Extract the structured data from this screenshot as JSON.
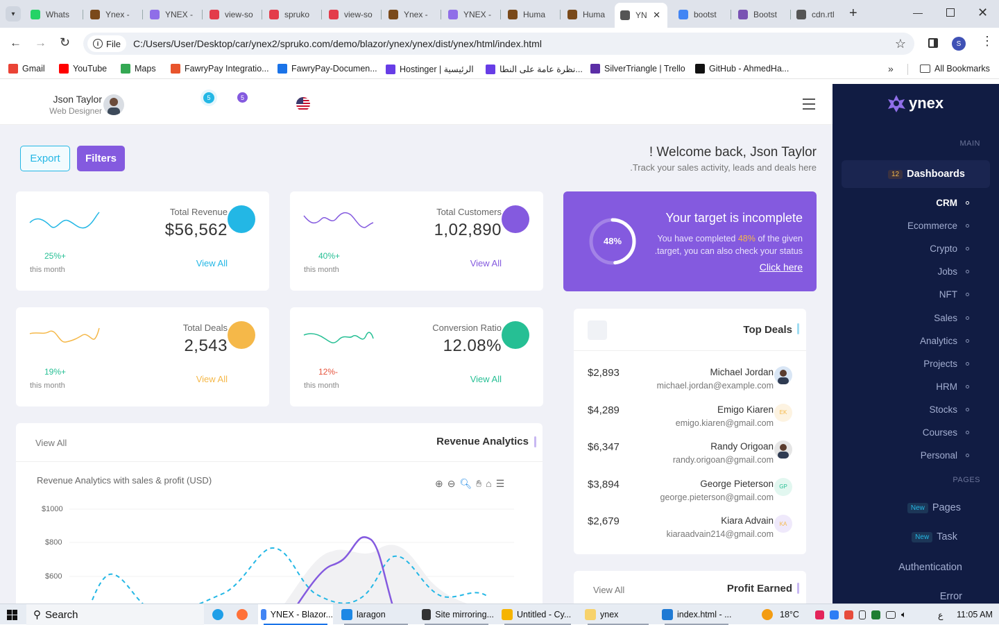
{
  "browser": {
    "tabs": [
      {
        "title": "Whats",
        "color": "#25d366"
      },
      {
        "title": "Ynex -",
        "color": "#7a4a1a"
      },
      {
        "title": "YNEX -",
        "color": "#8f6ee8"
      },
      {
        "title": "view-so",
        "color": "#e33b4a"
      },
      {
        "title": "spruko",
        "color": "#e33b4a"
      },
      {
        "title": "view-so",
        "color": "#e33b4a"
      },
      {
        "title": "Ynex -",
        "color": "#7a4a1a"
      },
      {
        "title": "YNEX -",
        "color": "#8f6ee8"
      },
      {
        "title": "Huma",
        "color": "#7a4a1a"
      },
      {
        "title": "Huma",
        "color": "#7a4a1a"
      },
      {
        "title": "YN",
        "color": "#555"
      },
      {
        "title": "bootst",
        "color": "#4285f4"
      },
      {
        "title": "Bootst",
        "color": "#7952b3"
      },
      {
        "title": "cdn.rtl",
        "color": "#555"
      }
    ],
    "address": {
      "scheme_label": "File",
      "url": "C:/Users/User/Desktop/car/ynex2/spruko.com/demo/blazor/ynex/ynex/dist/ynex/html/index.html"
    },
    "profile_initial": "S",
    "bookmarks": [
      {
        "label": "Gmail",
        "color": "#ea4335"
      },
      {
        "label": "YouTube",
        "color": "#ff0000"
      },
      {
        "label": "Maps",
        "color": "#34a853"
      },
      {
        "label": "FawryPay Integratio...",
        "color": "#e8542c"
      },
      {
        "label": "FawryPay-Documen...",
        "color": "#1a73e8"
      },
      {
        "label": "Hostinger | الرئيسية",
        "color": "#673de6"
      },
      {
        "label": "نظرة عامة على النطا...",
        "color": "#673de6"
      },
      {
        "label": "SilverTriangle | Trello",
        "color": "#5b2ea6"
      },
      {
        "label": "GitHub - AhmedHa...",
        "color": "#111"
      }
    ],
    "all_bookmarks_label": "All Bookmarks"
  },
  "header": {
    "user_name": "Json Taylor",
    "user_role": "Web Designer",
    "badge_1": "5",
    "badge_2": "5"
  },
  "welcome": {
    "title": "! Welcome back, Json Taylor",
    "subtitle": ".Track your sales activity, leads and deals here",
    "export_label": "Export",
    "filters_label": "Filters"
  },
  "stats": [
    {
      "title": "Total Revenue",
      "value": "$56,562",
      "change": "25%+",
      "period": "this month",
      "view_all": "View All",
      "color": "#23b7e5"
    },
    {
      "title": "Total Customers",
      "value": "1,02,890",
      "change": "40%+",
      "period": "this month",
      "view_all": "View All",
      "color": "#845adf"
    },
    {
      "title": "Total Deals",
      "value": "2,543",
      "change": "19%+",
      "period": "this month",
      "view_all": "View All",
      "color": "#f5b849"
    },
    {
      "title": "Conversion Ratio",
      "value": "12.08%",
      "change": "12%-",
      "period": "this month",
      "view_all": "View All",
      "color": "#26bf94"
    }
  ],
  "target": {
    "percent_label": "48%",
    "percent": 48,
    "title": "Your target is incomplete",
    "line1_pre": "You have completed",
    "line1_highlight": "48%",
    "line1_post": "of the given",
    "line2": ".target, you can also check your status",
    "link": "Click here"
  },
  "revenue": {
    "view_all": "View All",
    "title": "Revenue Analytics",
    "chart_subtitle": "Revenue Analytics with sales & profit (USD)",
    "y_ticks": [
      "$1000",
      "$800",
      "$600"
    ]
  },
  "top_deals": {
    "title": "Top Deals",
    "rows": [
      {
        "amount": "$2,893",
        "name": "Michael Jordan",
        "email": "michael.jordan@example.com",
        "initials": "",
        "avatar_bg": "#d9e6f5"
      },
      {
        "amount": "$4,289",
        "name": "Emigo Kiaren",
        "email": "emigo.kiaren@gmail.com",
        "initials": "EK",
        "avatar_bg": "#fdf3e1"
      },
      {
        "amount": "$6,347",
        "name": "Randy Origoan",
        "email": "randy.origoan@gmail.com",
        "initials": "",
        "avatar_bg": "#e5e5e5"
      },
      {
        "amount": "$3,894",
        "name": "George Pieterson",
        "email": "george.pieterson@gmail.com",
        "initials": "GP",
        "avatar_bg": "#e2f7f0"
      },
      {
        "amount": "$2,679",
        "name": "Kiara Advain",
        "email": "kiaraadvain214@gmail.com",
        "initials": "KA",
        "avatar_bg": "#efe9fb"
      }
    ]
  },
  "profit": {
    "view_all": "View All",
    "title": "Profit Earned"
  },
  "sidebar": {
    "logo": "ynex",
    "main_label": "MAIN",
    "dashboards_badge": "12",
    "dashboards_label": "Dashboards",
    "items": [
      "CRM",
      "Ecommerce",
      "Crypto",
      "Jobs",
      "NFT",
      "Sales",
      "Analytics",
      "Projects",
      "HRM",
      "Stocks",
      "Courses",
      "Personal"
    ],
    "pages_label": "PAGES",
    "new_badge": "New",
    "pages_item": "Pages",
    "task_item": "Task",
    "authentication": "Authentication",
    "error": "Error"
  },
  "taskbar": {
    "search": "Search",
    "apps": [
      {
        "label": "YNEX - Blazor...",
        "color": "#4285f4"
      },
      {
        "label": "laragon",
        "color": "#1e88e5"
      },
      {
        "label": "Site mirroring...",
        "color": "#333"
      },
      {
        "label": "Untitled - Cy...",
        "color": "#f6b400"
      },
      {
        "label": "ynex",
        "color": "#f7d26b"
      },
      {
        "label": "index.html - ...",
        "color": "#1f7ad4"
      }
    ],
    "temperature": "18°C",
    "language": "ع",
    "time": "11:05 AM"
  }
}
